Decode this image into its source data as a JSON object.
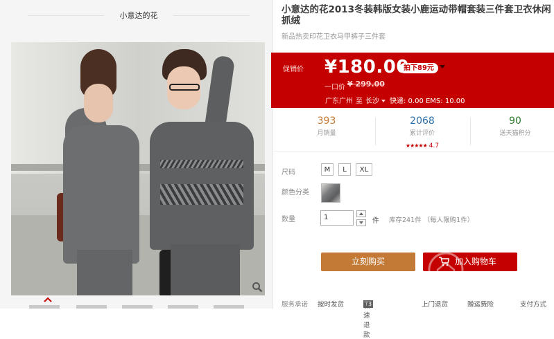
{
  "shop": {
    "name": "小意达的花"
  },
  "product": {
    "title": "小意达的花2013冬装韩版女装小鹿运动带帽套装三件套卫衣休闲抓绒",
    "subtitle": "新品热卖印花卫衣马甲裤子三件套"
  },
  "price_box": {
    "promo_label": "促销价",
    "price": "¥180.00",
    "badge": "拍下89元",
    "original_label": "一口价",
    "original_price": "¥ 299.00",
    "origin": "广东广州",
    "to": "至",
    "dest": "长沙",
    "shipping_fee": "快递: 0.00 EMS: 10.00",
    "accent_color": "#c40000"
  },
  "stats": [
    {
      "value": "393",
      "label": "月销量",
      "color": "#c27a36"
    },
    {
      "value": "2068",
      "label": "累计评价",
      "color": "#2e6fa8",
      "stars": "★★★★★",
      "rating": "4.7"
    },
    {
      "value": "90",
      "label": "送天猫积分",
      "color": "#2c7a2c"
    }
  ],
  "options": {
    "size_label": "尺码",
    "sizes": [
      "M",
      "L",
      "XL"
    ],
    "color_label": "颜色分类",
    "qty_label": "数量",
    "qty_value": "1",
    "qty_unit": "件",
    "stock": "库存241件 （每人限购1件）"
  },
  "actions": {
    "buy_now": "立刻购买",
    "add_to_cart": "加入购物车"
  },
  "services": {
    "label": "服务承诺",
    "items": [
      "按时发货",
      "极速退款",
      "上门退货",
      "赠运费险",
      "支付方式"
    ],
    "tag": "T3"
  }
}
